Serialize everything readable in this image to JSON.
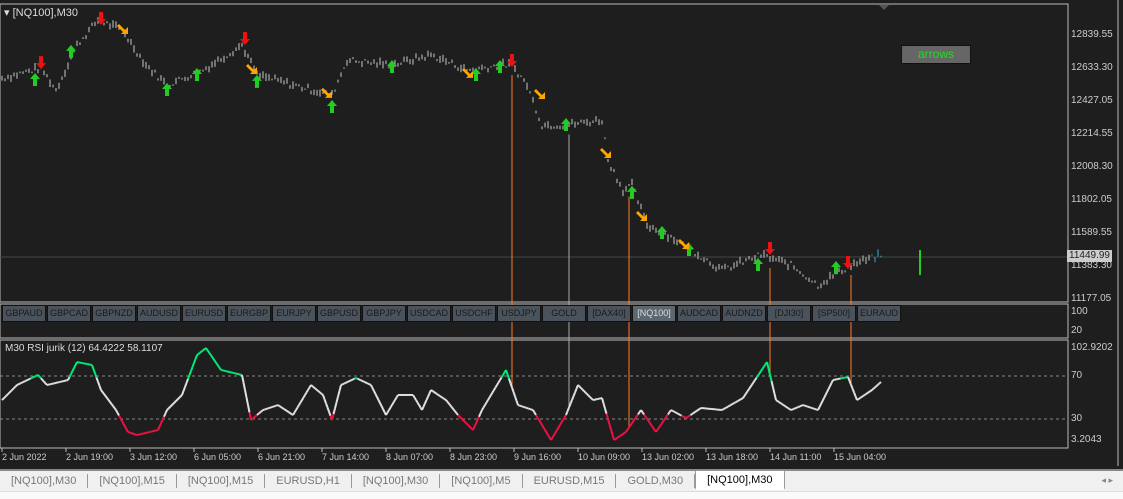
{
  "chart_title": "[NQ100],M30",
  "arrows_button": "arrows",
  "symbols": [
    "GBPAUD",
    "GBPCAD",
    "GBPNZD",
    "AUDUSD",
    "EURUSD",
    "EURGBP",
    "EURJPY",
    "GBPUSD",
    "GBPJPY",
    "USDCAD",
    "USDCHF",
    "USDJPY",
    "GOLD",
    "[DAX40]",
    "[NQ100]",
    "AUDCAD",
    "AUDNZD",
    "[DJI30]",
    "[SP500]",
    "EURAUD"
  ],
  "active_symbol": "[NQ100]",
  "price_axis": [
    "12839.55",
    "12633.30",
    "12427.05",
    "12214.55",
    "12008.30",
    "11802.05",
    "11589.55",
    "11383.30",
    "11177.05"
  ],
  "current_price": "11449.99",
  "strip_axis": [
    "100",
    "20"
  ],
  "indicator_label": "M30  RSI jurik (12) 64.4222 58.1107",
  "rsi_axis": {
    "max": "102.9202",
    "l70": "70",
    "l30": "30",
    "min": "3.2043"
  },
  "time_labels": [
    "2 Jun 2022",
    "2 Jun 19:00",
    "3 Jun 12:00",
    "6 Jun 05:00",
    "6 Jun 21:00",
    "7 Jun 14:00",
    "8 Jun 07:00",
    "8 Jun 23:00",
    "9 Jun 16:00",
    "10 Jun 09:00",
    "13 Jun 02:00",
    "13 Jun 18:00",
    "14 Jun 11:00",
    "15 Jun 04:00"
  ],
  "tabs": [
    "[NQ100],M30",
    "[NQ100],M15",
    "[NQ100],M15",
    "EURUSD,H1",
    "[NQ100],M30",
    "[NQ100],M5",
    "EURUSD,M15",
    "GOLD,M30",
    "[NQ100],M30"
  ],
  "active_tab": 8,
  "colors": {
    "up": "#22cc22",
    "down": "#ee1111",
    "side": "#ffa500",
    "rsi_high": "#00ee77",
    "rsi_low": "#ee1144",
    "rsi_mid": "#e0e0e0",
    "line": "#ff7f27"
  },
  "chart_data": {
    "type": "line",
    "ylim": [
      11177.05,
      12839.55
    ],
    "price_anchors": [
      [
        0,
        12568
      ],
      [
        13,
        12632
      ],
      [
        18,
        12493
      ],
      [
        25,
        12777
      ],
      [
        32,
        12934
      ],
      [
        40,
        12871
      ],
      [
        48,
        12651
      ],
      [
        55,
        12525
      ],
      [
        67,
        12619
      ],
      [
        80,
        12777
      ],
      [
        85,
        12588
      ],
      [
        97,
        12525
      ],
      [
        110,
        12462
      ],
      [
        115,
        12682
      ],
      [
        130,
        12651
      ],
      [
        143,
        12714
      ],
      [
        155,
        12619
      ],
      [
        167,
        12651
      ],
      [
        170,
        12651
      ],
      [
        175,
        12525
      ],
      [
        180,
        12273
      ],
      [
        188,
        12273
      ],
      [
        200,
        12305
      ],
      [
        202,
        12053
      ],
      [
        207,
        11864
      ],
      [
        210,
        11895
      ],
      [
        215,
        11643
      ],
      [
        222,
        11580
      ],
      [
        230,
        11485
      ],
      [
        240,
        11359
      ],
      [
        253,
        11454
      ],
      [
        263,
        11391
      ],
      [
        272,
        11265
      ],
      [
        283,
        11391
      ],
      [
        293,
        11454
      ]
    ],
    "arrows": [
      {
        "bar": 13,
        "price": 12669,
        "type": "down"
      },
      {
        "bar": 33,
        "price": 12947,
        "type": "down"
      },
      {
        "bar": 81,
        "price": 12821,
        "type": "down"
      },
      {
        "bar": 170,
        "price": 12682,
        "type": "down"
      },
      {
        "bar": 256,
        "price": 11498,
        "type": "down"
      },
      {
        "bar": 282,
        "price": 11410,
        "type": "down"
      },
      {
        "bar": 11,
        "price": 12556,
        "type": "up"
      },
      {
        "bar": 23,
        "price": 12733,
        "type": "up"
      },
      {
        "bar": 55,
        "price": 12493,
        "type": "up"
      },
      {
        "bar": 65,
        "price": 12588,
        "type": "up"
      },
      {
        "bar": 85,
        "price": 12544,
        "type": "up"
      },
      {
        "bar": 110,
        "price": 12386,
        "type": "up"
      },
      {
        "bar": 130,
        "price": 12638,
        "type": "up"
      },
      {
        "bar": 158,
        "price": 12588,
        "type": "up"
      },
      {
        "bar": 166,
        "price": 12638,
        "type": "up"
      },
      {
        "bar": 188,
        "price": 12273,
        "type": "up"
      },
      {
        "bar": 210,
        "price": 11845,
        "type": "up"
      },
      {
        "bar": 220,
        "price": 11593,
        "type": "up"
      },
      {
        "bar": 229,
        "price": 11486,
        "type": "up"
      },
      {
        "bar": 252,
        "price": 11391,
        "type": "up"
      },
      {
        "bar": 278,
        "price": 11372,
        "type": "up"
      },
      {
        "bar": 40,
        "price": 12884,
        "type": "side"
      },
      {
        "bar": 83,
        "price": 12632,
        "type": "side"
      },
      {
        "bar": 108,
        "price": 12481,
        "type": "side"
      },
      {
        "bar": 155,
        "price": 12607,
        "type": "side"
      },
      {
        "bar": 179,
        "price": 12474,
        "type": "side"
      },
      {
        "bar": 201,
        "price": 12103,
        "type": "side"
      },
      {
        "bar": 213,
        "price": 11706,
        "type": "side"
      },
      {
        "bar": 227,
        "price": 11530,
        "type": "side"
      }
    ],
    "signal_lines": [
      {
        "bar": 170,
        "color": "#ff7f27"
      },
      {
        "bar": 189,
        "color": "#aaaaaa"
      },
      {
        "bar": 209,
        "color": "#ff7f27"
      },
      {
        "bar": 256,
        "color": "#ff7f27"
      },
      {
        "bar": 283,
        "color": "#ff7f27"
      }
    ],
    "rsi_ylim": [
      3.2043,
      102.9202
    ],
    "rsi_levels": [
      70,
      30
    ],
    "rsi": [
      [
        0,
        46.5
      ],
      [
        5,
        62.8
      ],
      [
        12,
        73.7
      ],
      [
        15,
        62.8
      ],
      [
        22,
        68.2
      ],
      [
        25,
        87.7
      ],
      [
        30,
        84.5
      ],
      [
        33,
        57.4
      ],
      [
        38,
        35.7
      ],
      [
        42,
        11.9
      ],
      [
        45,
        8.6
      ],
      [
        52,
        14.0
      ],
      [
        55,
        35.7
      ],
      [
        60,
        52.0
      ],
      [
        65,
        95.3
      ],
      [
        68,
        102.9
      ],
      [
        73,
        79.1
      ],
      [
        80,
        73.7
      ],
      [
        83,
        24.9
      ],
      [
        87,
        35.7
      ],
      [
        92,
        41.1
      ],
      [
        97,
        30.3
      ],
      [
        100,
        46.5
      ],
      [
        103,
        62.8
      ],
      [
        107,
        52.0
      ],
      [
        110,
        24.9
      ],
      [
        113,
        62.8
      ],
      [
        118,
        70.4
      ],
      [
        123,
        62.8
      ],
      [
        128,
        30.3
      ],
      [
        132,
        52.0
      ],
      [
        137,
        52.0
      ],
      [
        140,
        35.7
      ],
      [
        143,
        57.4
      ],
      [
        148,
        46.5
      ],
      [
        152,
        30.3
      ],
      [
        157,
        14.0
      ],
      [
        160,
        35.7
      ],
      [
        163,
        52.0
      ],
      [
        168,
        79.1
      ],
      [
        172,
        41.1
      ],
      [
        177,
        35.7
      ],
      [
        183,
        3.2
      ],
      [
        188,
        30.3
      ],
      [
        192,
        62.8
      ],
      [
        197,
        46.5
      ],
      [
        200,
        48.7
      ],
      [
        204,
        3.2
      ],
      [
        208,
        11.9
      ],
      [
        213,
        35.7
      ],
      [
        218,
        11.9
      ],
      [
        223,
        35.7
      ],
      [
        228,
        27.0
      ],
      [
        233,
        37.9
      ],
      [
        240,
        35.7
      ],
      [
        247,
        48.7
      ],
      [
        251,
        68.2
      ],
      [
        255,
        87.7
      ],
      [
        258,
        46.5
      ],
      [
        263,
        35.7
      ],
      [
        267,
        41.1
      ],
      [
        272,
        35.7
      ],
      [
        277,
        68.2
      ],
      [
        282,
        71.5
      ],
      [
        285,
        46.5
      ],
      [
        290,
        57.4
      ],
      [
        293,
        66.1
      ]
    ]
  }
}
